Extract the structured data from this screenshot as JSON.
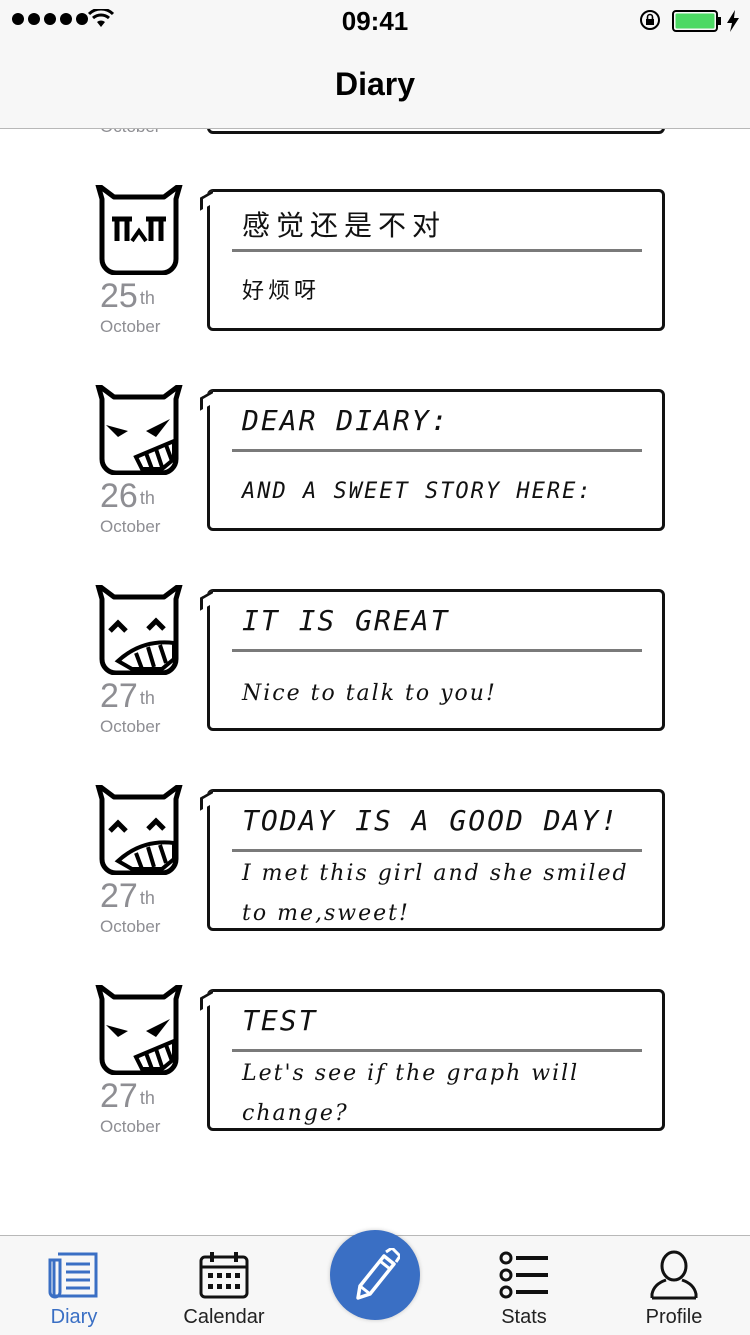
{
  "status_bar": {
    "time": "09:41"
  },
  "nav": {
    "title": "Diary"
  },
  "partial_top": {
    "month": "October"
  },
  "entries": [
    {
      "day": "25",
      "suffix": "th",
      "month": "October",
      "mood": "crying-face",
      "title": "感觉还是不对",
      "body": "好烦呀"
    },
    {
      "day": "26",
      "suffix": "th",
      "month": "October",
      "mood": "angry-face",
      "title": "DEAR DIARY:",
      "body": "AND A SWEET STORY HERE:"
    },
    {
      "day": "27",
      "suffix": "th",
      "month": "October",
      "mood": "grinning-face",
      "title": "IT IS GREAT",
      "body": "Nice to talk to you!"
    },
    {
      "day": "27",
      "suffix": "th",
      "month": "October",
      "mood": "grinning-face",
      "title": "TODAY IS A GOOD DAY!",
      "body": "I met this girl and she smiled to me,sweet!"
    },
    {
      "day": "27",
      "suffix": "th",
      "month": "October",
      "mood": "angry-face",
      "title": "TEST",
      "body": "Let's see if the graph will change?"
    }
  ],
  "tabs": {
    "diary": "Diary",
    "calendar": "Calendar",
    "stats": "Stats",
    "profile": "Profile"
  },
  "colors": {
    "accent": "#3a6fc4",
    "date_text": "#8e8e93"
  }
}
